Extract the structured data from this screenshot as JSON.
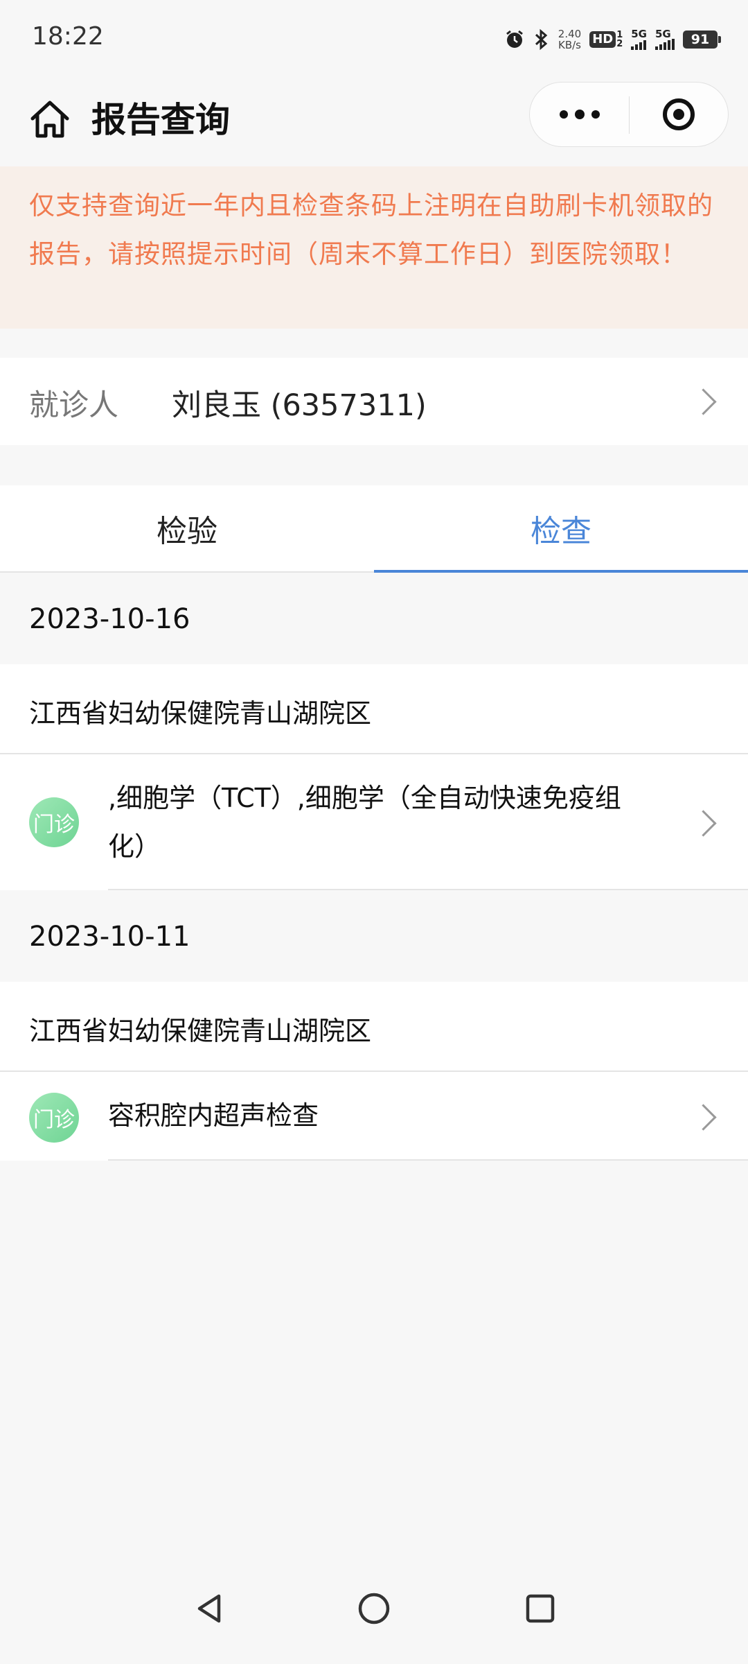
{
  "status_bar": {
    "time": "18:22",
    "net_speed_value": "2.40",
    "net_speed_unit": "KB/s",
    "hd_label": "HD",
    "hd_sup": "1",
    "hd_sub": "2",
    "sim1_label": "5G",
    "sim2_label": "5G",
    "battery": "91",
    "icons": [
      "alarm-icon",
      "bluetooth-icon",
      "signal-icon",
      "battery-icon"
    ]
  },
  "header": {
    "title": "报告查询",
    "home_icon": "home-icon",
    "more_icon": "more-icon",
    "close_icon": "target-icon"
  },
  "notice": {
    "text": "仅支持查询近一年内且检查条码上注明在自助刷卡机领取的报告，请按照提示时间（周末不算工作日）到医院领取！",
    "color": "#f07a4f",
    "background": "#f8efe9"
  },
  "patient": {
    "label": "就诊人",
    "value": "刘良玉 (6357311)"
  },
  "tabs": [
    {
      "label": "检验",
      "active": false
    },
    {
      "label": "检查",
      "active": true
    }
  ],
  "accent_color": "#4a86d8",
  "reports": [
    {
      "date": "2023-10-16",
      "hospital": "江西省妇幼保健院青山湖院区",
      "items": [
        {
          "badge": "门诊",
          "name": ",细胞学（TCT）,细胞学（全自动快速免疫组化）"
        }
      ]
    },
    {
      "date": "2023-10-11",
      "hospital": "江西省妇幼保健院青山湖院区",
      "items": [
        {
          "badge": "门诊",
          "name": "容积腔内超声检查"
        }
      ]
    }
  ]
}
